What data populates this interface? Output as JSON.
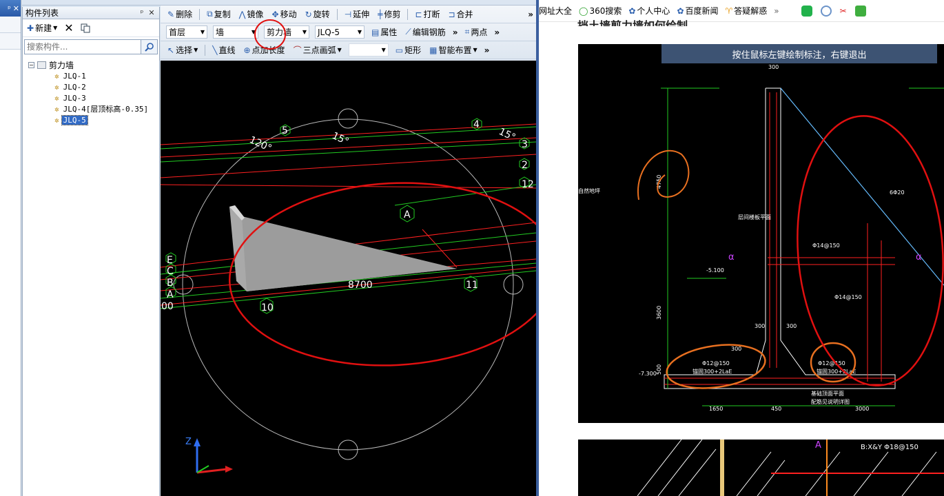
{
  "left_strip": {
    "close": "✕",
    "pin": "ᵖ"
  },
  "panel": {
    "title": "构件列表",
    "pin": "ᵖ",
    "close": "✕",
    "tools": {
      "new_label": "新建",
      "delete_icon": "✕",
      "copy_icon": "copy"
    },
    "search": {
      "placeholder": "搜索构件..."
    },
    "tree": {
      "root": "剪力墙",
      "items": [
        "JLQ-1",
        "JLQ-2",
        "JLQ-3",
        "JLQ-4[层顶标高-0.35]",
        "JLQ-5"
      ],
      "selected_index": 4
    }
  },
  "toolbar1": {
    "delete": "删除",
    "copy": "复制",
    "mirror": "镜像",
    "move": "移动",
    "rotate": "旋转",
    "extend": "延伸",
    "trim": "修剪",
    "break": "打断",
    "merge": "合并",
    "more": "»"
  },
  "toolbar2": {
    "floor": "首层",
    "type": "墙",
    "subtype": "剪力墙",
    "component": "JLQ-5",
    "properties": "属性",
    "edit_rebar": "编辑钢筋",
    "more": "»",
    "two_point": "两点",
    "more2": "»"
  },
  "toolbar3": {
    "select": "选择",
    "line": "直线",
    "point_length": "点加长度",
    "arc": "三点画弧",
    "rect": "矩形",
    "smart_layout": "智能布置",
    "more": "»"
  },
  "canvas": {
    "labels": {
      "angle1": "120°",
      "angle2": "15°",
      "angle3": "15°",
      "axis_5": "5",
      "axis_4": "4",
      "axis_3": "3",
      "axis_2": "2",
      "axis_12": "12",
      "axis_A_mid": "A",
      "axis_E": "E",
      "axis_C": "C",
      "axis_B": "B",
      "axis_A": "A",
      "axis_10": "10",
      "axis_11": "11",
      "dim": "8700",
      "dim_left": "00",
      "coord_z": "Z"
    }
  },
  "browser": {
    "bookmarks": [
      "网址大全",
      "360搜索",
      "个人中心",
      "百度新闻",
      "答疑解惑"
    ],
    "more": "»",
    "heading": "挡土墙剪力墙如何绘制",
    "image1": {
      "tip": "按住鼠标左键绘制标注，右键退出",
      "texts": {
        "top_dim": "300",
        "h_dim1": "4750",
        "h_dim2": "3600",
        "h_dim3": "500",
        "rebar1": "6Φ20",
        "rebar2": "Φ14@150",
        "rebar3": "Φ14@150",
        "rebar4": "Φ12@150",
        "rebar5": "Φ12@150",
        "anchor1": "锚固300+2LaE",
        "anchor2": "锚固300+2LaE",
        "level1": "-5.100",
        "level2": "-7.300",
        "mark_a1": "α",
        "mark_a2": "α",
        "note1": "层间楼板平面",
        "note2": "基础顶面平面",
        "note3": "配筋见说明详图",
        "left_note": "自然地坪",
        "bottom_dim1": "1650",
        "bottom_dim2": "450",
        "bottom_dim3": "3000",
        "mid_dim1": "300",
        "mid_dim2": "300",
        "mid_dim3": "300"
      }
    },
    "image2": {
      "text1": "B:X&Y Φ18@150",
      "text2": "A"
    }
  }
}
